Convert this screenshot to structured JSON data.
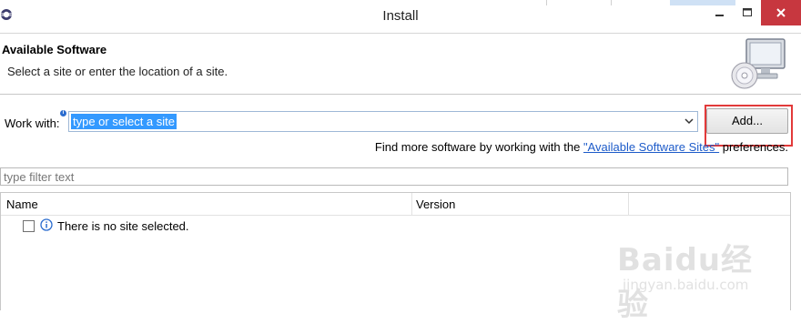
{
  "window": {
    "title": "Install"
  },
  "banner": {
    "title": "Available Software",
    "subtitle": "Select a site or enter the location of a site.",
    "icon": "computer-cd-icon"
  },
  "work_with": {
    "label": "Work with:",
    "value": "type or select a site",
    "add_button": "Add..."
  },
  "find_more": {
    "prefix": "Find more software by working with the ",
    "link": "\"Available Software Sites\"",
    "suffix": " preferences."
  },
  "filter": {
    "placeholder": "type filter text"
  },
  "table": {
    "columns": [
      "Name",
      "Version"
    ],
    "rows": [
      {
        "text": "There is no site selected.",
        "checked": false,
        "icon": "info-icon"
      }
    ]
  },
  "watermark": {
    "logo": "Baidu经验",
    "url": "jingyan.baidu.com"
  },
  "colors": {
    "selection": "#3399ff",
    "link": "#1d5bc9",
    "close_button": "#c7373f",
    "highlight": "#e23a3a"
  }
}
